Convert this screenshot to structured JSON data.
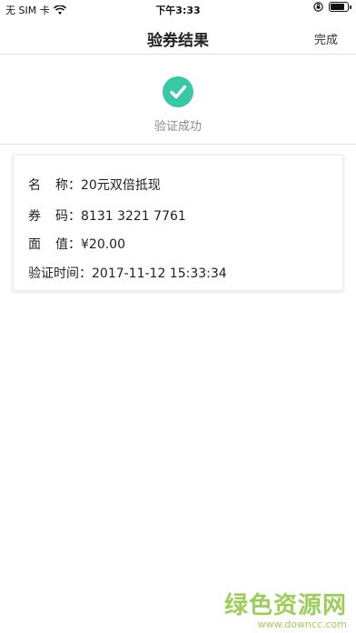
{
  "status_bar": {
    "carrier": "无 SIM 卡",
    "time": "下午3:33"
  },
  "nav": {
    "title": "验券结果",
    "done_label": "完成"
  },
  "result": {
    "status_text": "验证成功",
    "status_color": "#39c8a5"
  },
  "coupon": {
    "name_label_a": "名",
    "name_label_b": "称：",
    "name_value": "20元双倍抵现",
    "code_label_a": "券",
    "code_label_b": "码：",
    "code_value": "8131 3221 7761",
    "face_label_a": "面",
    "face_label_b": "值：",
    "face_value": "¥20.00",
    "time_label": "验证时间：",
    "time_value": "2017-11-12 15:33:34"
  },
  "watermark": {
    "title": "绿色资源网",
    "url": "www.downcc.com"
  }
}
